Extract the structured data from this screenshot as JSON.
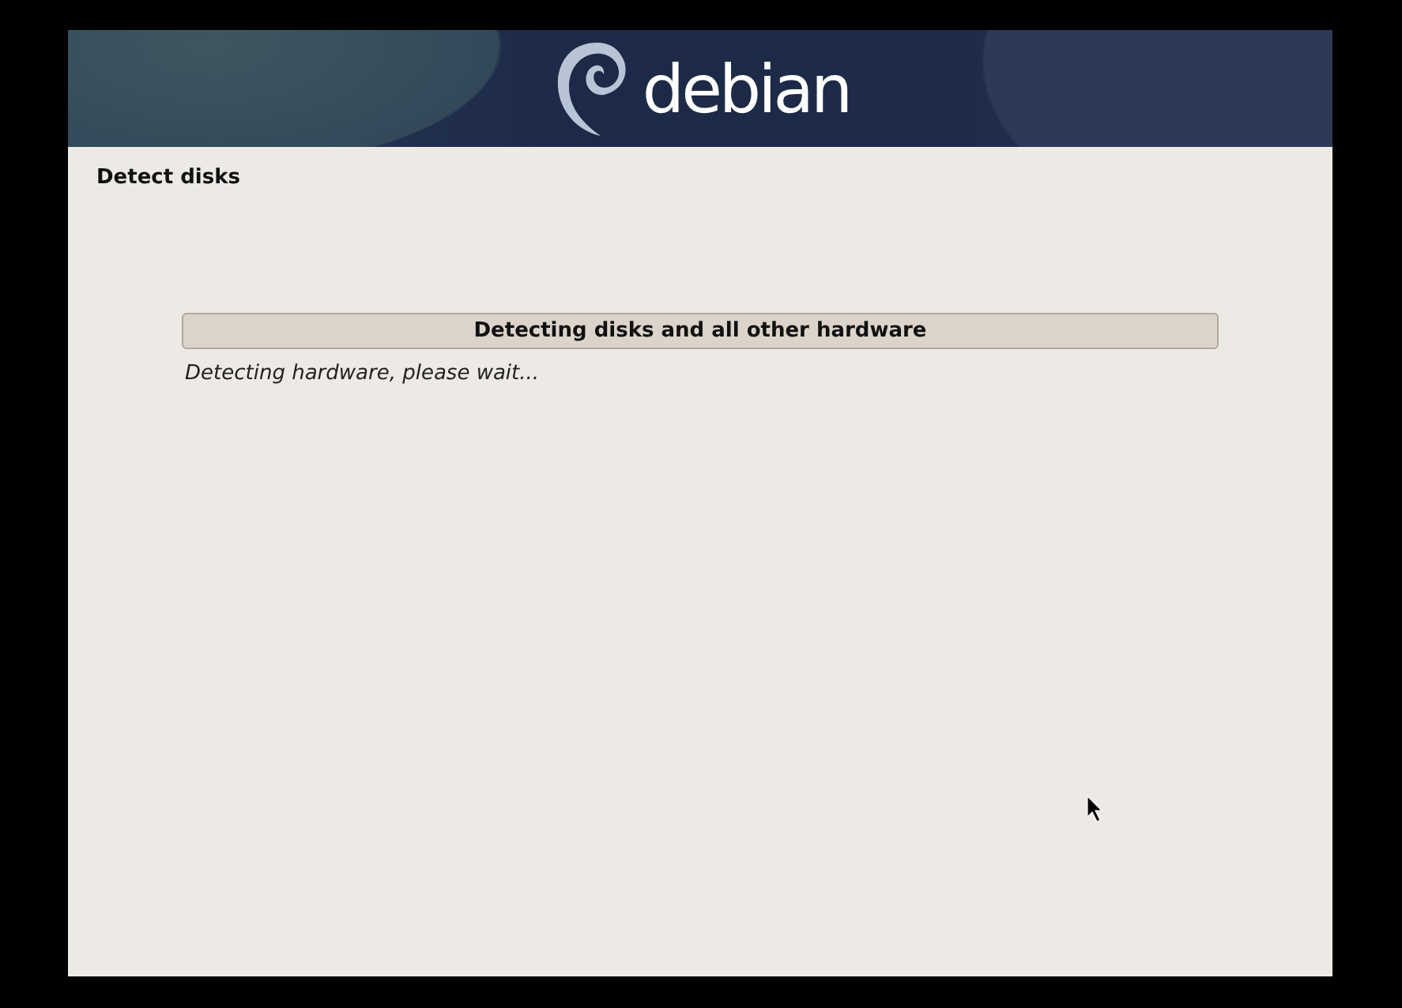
{
  "header": {
    "logo_text": "debian"
  },
  "step_title": "Detect disks",
  "progress": {
    "title": "Detecting disks and all other hardware",
    "message": "Detecting hardware, please wait..."
  }
}
